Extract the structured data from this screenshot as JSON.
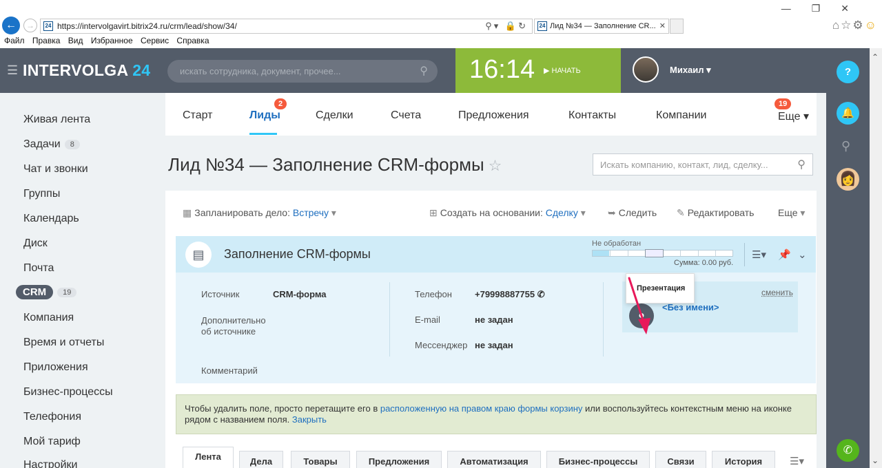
{
  "browser": {
    "url": "https://intervolgavirt.bitrix24.ru/crm/lead/show/34/",
    "favicon": "24",
    "tab_title": "Лид №34 — Заполнение CR...",
    "menu": [
      "Файл",
      "Правка",
      "Вид",
      "Избранное",
      "Сервис",
      "Справка"
    ]
  },
  "header": {
    "logo_main": "INTERVOLGA",
    "logo_num": "24",
    "search_placeholder": "искать сотрудника, документ, прочее...",
    "time": "16:14",
    "start_label": "НАЧАТЬ",
    "user_name": "Михаил"
  },
  "right_panel": {
    "help": "?"
  },
  "left_menu": {
    "items": [
      {
        "label": "Живая лента"
      },
      {
        "label": "Задачи",
        "counter": "8"
      },
      {
        "label": "Чат и звонки"
      },
      {
        "label": "Группы"
      },
      {
        "label": "Календарь"
      },
      {
        "label": "Диск"
      },
      {
        "label": "Почта"
      },
      {
        "label": "CRM",
        "counter": "19"
      },
      {
        "label": "Компания"
      },
      {
        "label": "Время и отчеты"
      },
      {
        "label": "Приложения"
      },
      {
        "label": "Бизнес-процессы"
      },
      {
        "label": "Телефония"
      },
      {
        "label": "Мой тариф"
      },
      {
        "label": "Настройки"
      }
    ]
  },
  "crm_tabs": {
    "items": [
      "Старт",
      "Лиды",
      "Сделки",
      "Счета",
      "Предложения",
      "Контакты",
      "Компании",
      "Еще"
    ],
    "leads_badge": "2",
    "more_badge": "19"
  },
  "page": {
    "title": "Лид №34 — Заполнение CRM-формы",
    "filter_placeholder": "Искать компанию, контакт, лид, сделку..."
  },
  "toolbar": {
    "plan_label": "Запланировать дело:",
    "plan_value": "Встречу",
    "create_label": "Создать на основании:",
    "create_value": "Сделку",
    "follow": "Следить",
    "edit": "Редактировать",
    "more": "Еще"
  },
  "lead": {
    "title": "Заполнение CRM-формы",
    "status": "Не обработан",
    "status_progress": 0.12,
    "sum_label": "Сумма:",
    "sum_value": "0.00 руб.",
    "tooltip": "Презентация",
    "fields": {
      "source_label": "Источник",
      "source_value": "CRM-форма",
      "extra_label_1": "Дополнительно",
      "extra_label_2": "об источнике",
      "comment_label": "Комментарий",
      "phone_label": "Телефон",
      "phone_value": "+79998887755",
      "email_label": "E-mail",
      "email_value": "не задан",
      "messenger_label": "Мессенджер",
      "messenger_value": "не задан"
    },
    "contact": {
      "change": "сменить",
      "name": "<Без имени>"
    }
  },
  "hint": {
    "text_1": "Чтобы удалить поле, просто перетащите его в ",
    "link_1": "расположенную на правом краю формы корзину",
    "text_2": " или воспользуйтесь контекстным меню на иконке рядом с названием поля. ",
    "link_2": "Закрыть"
  },
  "bottom_tabs": [
    "Лента",
    "Дела",
    "Товары",
    "Предложения",
    "Автоматизация",
    "Бизнес-процессы",
    "Связи",
    "История"
  ],
  "colors": {
    "header_bg": "#535c69",
    "accent_blue": "#2fc6f6",
    "clock_green": "#8dba3a",
    "badge_red": "#f55a3c",
    "annotation_arrow": "#e8195a"
  }
}
